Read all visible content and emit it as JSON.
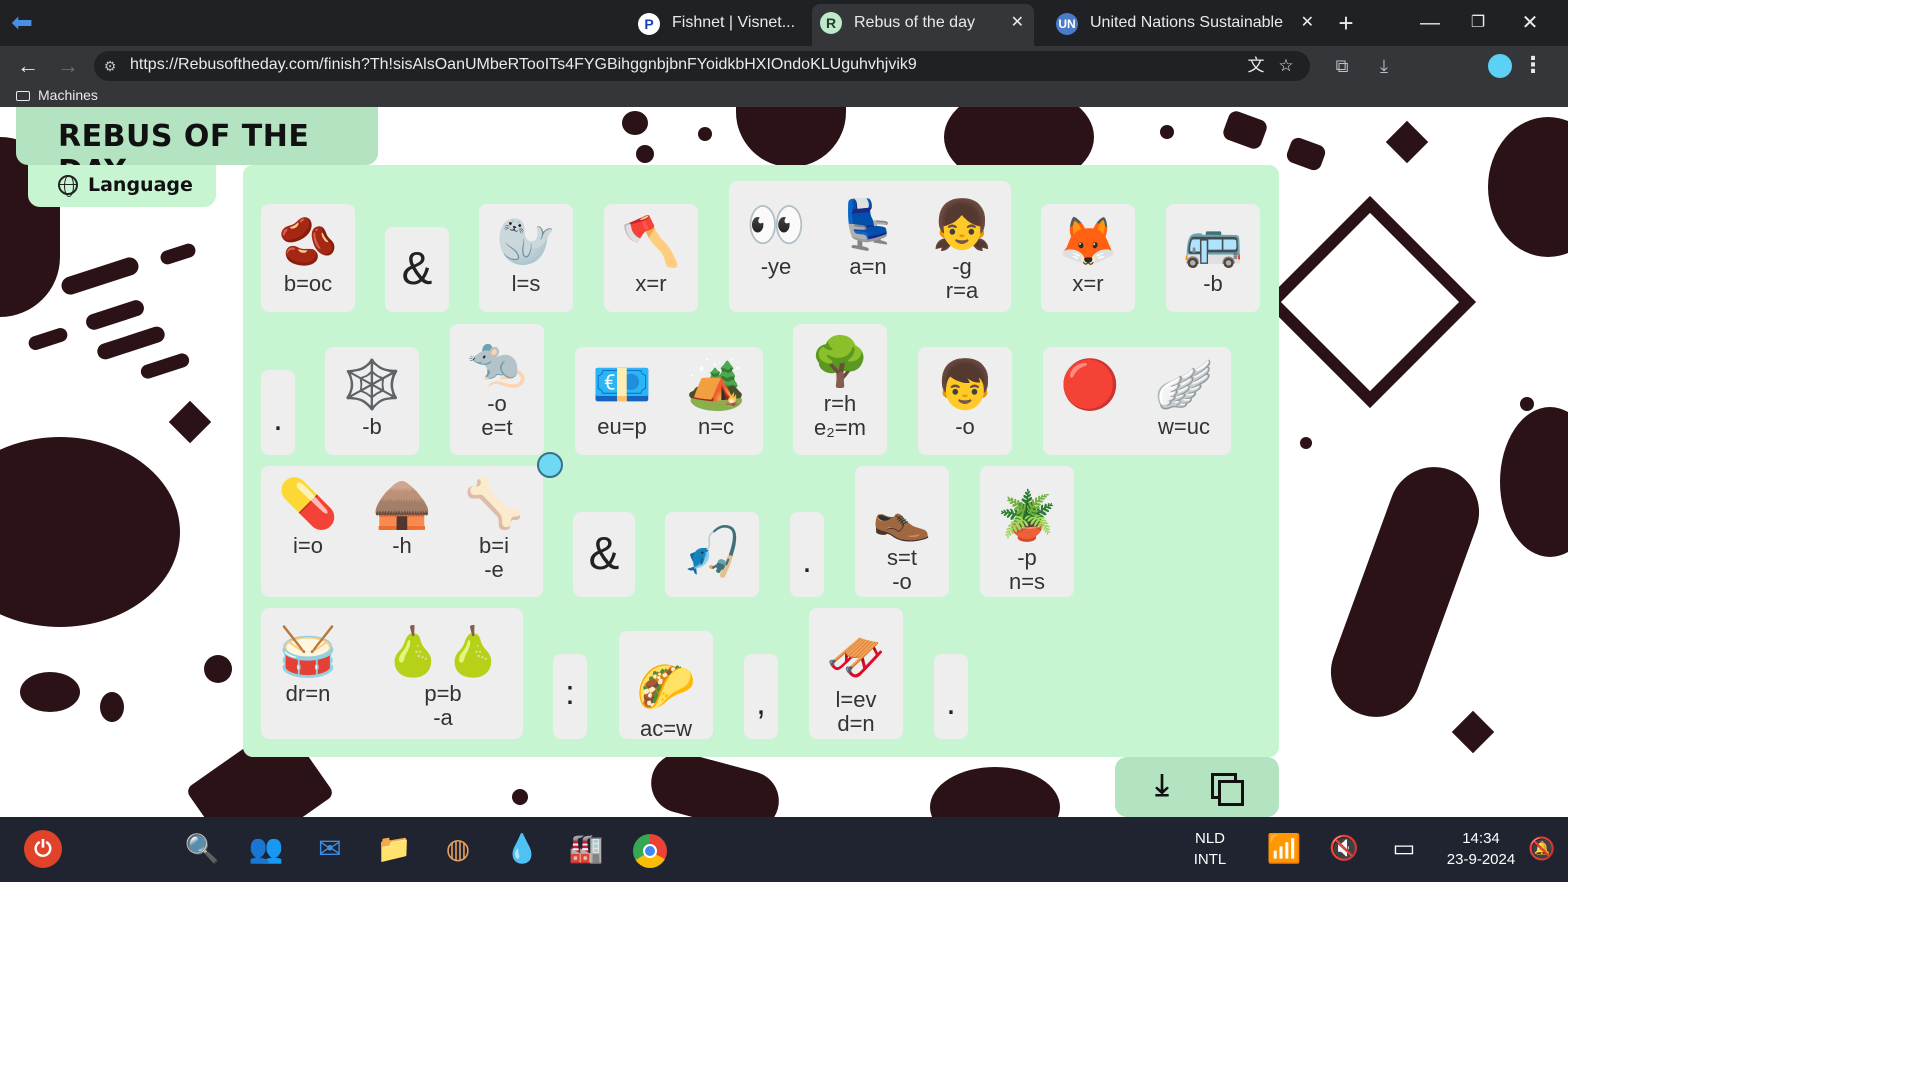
{
  "browser": {
    "tabs": [
      {
        "favicon": "P",
        "title": "Fishnet | Visnet..."
      },
      {
        "favicon": "R",
        "title": "Rebus of the day",
        "close": "✕"
      },
      {
        "favicon": "UN",
        "title": "United Nations Sustainable",
        "close": "✕"
      }
    ],
    "new_tab": "+",
    "url": "https://Rebusoftheday.com/finish?Th!sisAlsOanUMbeRTooITs4FYGBihggnbjbnFYoidkbHXIOndoKLUguhvhjvik9",
    "bookmarks": [
      {
        "label": "Machines"
      }
    ]
  },
  "page": {
    "title": "REBUS OF THE DAY",
    "language_button": "Language"
  },
  "rebus": {
    "row1": [
      {
        "emoji": "🫘",
        "label": "b=oc"
      },
      {
        "symbol": "&"
      },
      {
        "emoji": "🦭",
        "label": "l=s"
      },
      {
        "emoji": "🪓",
        "label": "x=r"
      },
      {
        "emoji": "👀",
        "label": "-ye"
      },
      {
        "emoji": "💺",
        "label": "a=n"
      },
      {
        "emoji": "👧",
        "label": "-g\nr=a"
      },
      {
        "emoji": "🦊",
        "label": "x=r"
      },
      {
        "emoji": "🚌",
        "label": "-b"
      }
    ],
    "row2": [
      {
        "symbol": "."
      },
      {
        "emoji": "🕸️",
        "label": "-b"
      },
      {
        "emoji": "🐀",
        "label": "-o\ne=t"
      },
      {
        "emoji": "💶",
        "label": "eu=p"
      },
      {
        "emoji": "🏕️",
        "label": "n=c"
      },
      {
        "emoji": "🌳",
        "label": "r=h\ne₂=m"
      },
      {
        "emoji": "👦",
        "label": "-o"
      },
      {
        "emoji": "🔴",
        "label": ""
      },
      {
        "emoji": "🪽",
        "label": "w=uc"
      }
    ],
    "row3": [
      {
        "emoji": "💊",
        "label": "i=o"
      },
      {
        "emoji": "🛖",
        "label": "-h"
      },
      {
        "emoji": "🦴",
        "label": "b=i\n-e"
      },
      {
        "symbol": "&"
      },
      {
        "emoji": "🎣",
        "label": ""
      },
      {
        "symbol": "."
      },
      {
        "emoji": "👞",
        "label": "s=t\n-o"
      },
      {
        "emoji": "🪴",
        "label": "-p\nn=s"
      }
    ],
    "row4": [
      {
        "emoji": "🥁",
        "label": "dr=n"
      },
      {
        "emoji": "🍐🍐",
        "label": "p=b\n-a"
      },
      {
        "symbol": ":"
      },
      {
        "emoji": "🌮",
        "label": "ac=w"
      },
      {
        "symbol": ","
      },
      {
        "emoji": "🛷",
        "label": "l=ev\nd=n"
      },
      {
        "symbol": "."
      }
    ]
  },
  "actions": {
    "download_icon": "download-icon",
    "copy_icon": "copy-icon"
  },
  "taskbar": {
    "lang_top": "NLD",
    "lang_bottom": "INTL",
    "time": "14:34",
    "date": "23-9-2024"
  }
}
